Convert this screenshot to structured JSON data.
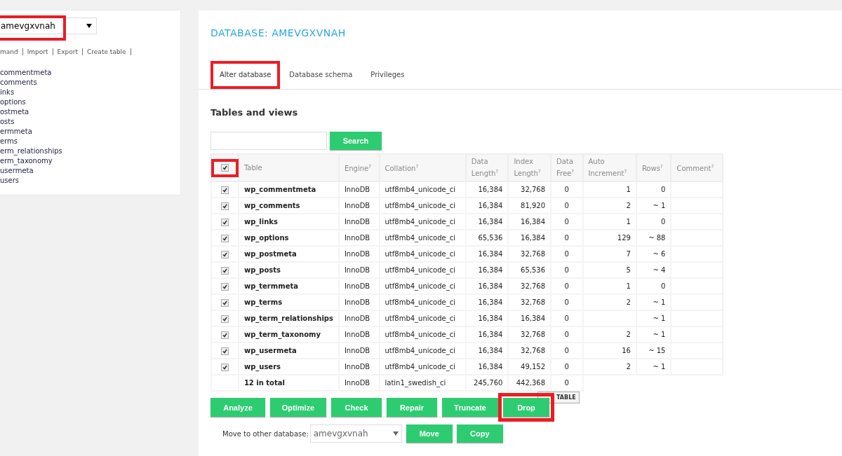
{
  "sidebar": {
    "database_select": {
      "value": "amevgxvnah",
      "highlighted": true
    },
    "links": [
      "mand",
      "Import",
      "Export",
      "Create table"
    ],
    "tables": [
      "commentmeta",
      "comments",
      "inks",
      "options",
      "ostmeta",
      "osts",
      "ermmeta",
      "erms",
      "erm_relationships",
      "erm_taxonomy",
      "usermeta",
      "users"
    ]
  },
  "main": {
    "title": "DATABASE: AMEVGXVNAH",
    "tabs": [
      {
        "label": "Alter database",
        "selected": true,
        "highlighted": true
      },
      {
        "label": "Database schema",
        "selected": false,
        "highlighted": false
      },
      {
        "label": "Privileges",
        "selected": false,
        "highlighted": false
      }
    ],
    "section_title": "Tables and views",
    "search": {
      "button": "Search"
    },
    "table": {
      "select_all": {
        "checked": true,
        "highlighted": true
      },
      "columns": [
        "Table",
        "Engine$^{?}$",
        "Collation$^{?}$",
        "Data Length$^{?}$",
        "Index Length$^{?}$",
        "Data Free$^{?}$",
        "Auto Increment$^{?}$",
        "Rows$^{?}$",
        "Comment$^{?}$"
      ],
      "rows": [
        {
          "checked": true,
          "cells": [
            "wp_commentmeta",
            "InnoDB",
            "utf8mb4_unicode_ci",
            "16,384",
            "32,768",
            "0",
            "1",
            "0",
            ""
          ]
        },
        {
          "checked": true,
          "cells": [
            "wp_comments",
            "InnoDB",
            "utf8mb4_unicode_ci",
            "16,384",
            "81,920",
            "0",
            "2",
            "~ 1",
            ""
          ]
        },
        {
          "checked": true,
          "cells": [
            "wp_links",
            "InnoDB",
            "utf8mb4_unicode_ci",
            "16,384",
            "16,384",
            "0",
            "1",
            "0",
            ""
          ]
        },
        {
          "checked": true,
          "cells": [
            "wp_options",
            "InnoDB",
            "utf8mb4_unicode_ci",
            "65,536",
            "16,384",
            "0",
            "129",
            "~ 88",
            ""
          ]
        },
        {
          "checked": true,
          "cells": [
            "wp_postmeta",
            "InnoDB",
            "utf8mb4_unicode_ci",
            "16,384",
            "32,768",
            "0",
            "7",
            "~ 6",
            ""
          ]
        },
        {
          "checked": true,
          "cells": [
            "wp_posts",
            "InnoDB",
            "utf8mb4_unicode_ci",
            "16,384",
            "65,536",
            "0",
            "5",
            "~ 4",
            ""
          ]
        },
        {
          "checked": true,
          "cells": [
            "wp_termmeta",
            "InnoDB",
            "utf8mb4_unicode_ci",
            "16,384",
            "32,768",
            "0",
            "1",
            "0",
            ""
          ]
        },
        {
          "checked": true,
          "cells": [
            "wp_terms",
            "InnoDB",
            "utf8mb4_unicode_ci",
            "16,384",
            "32,768",
            "0",
            "2",
            "~ 1",
            ""
          ]
        },
        {
          "checked": true,
          "cells": [
            "wp_term_relationships",
            "InnoDB",
            "utf8mb4_unicode_ci",
            "16,384",
            "16,384",
            "0",
            "",
            "~ 1",
            ""
          ]
        },
        {
          "checked": true,
          "cells": [
            "wp_term_taxonomy",
            "InnoDB",
            "utf8mb4_unicode_ci",
            "16,384",
            "32,768",
            "0",
            "2",
            "~ 1",
            ""
          ]
        },
        {
          "checked": true,
          "cells": [
            "wp_usermeta",
            "InnoDB",
            "utf8mb4_unicode_ci",
            "16,384",
            "32,768",
            "0",
            "16",
            "~ 15",
            ""
          ]
        },
        {
          "checked": true,
          "cells": [
            "wp_users",
            "InnoDB",
            "utf8mb4_unicode_ci",
            "16,384",
            "49,152",
            "0",
            "2",
            "~ 1",
            ""
          ]
        }
      ],
      "total": [
        "12 in total",
        "InnoDB",
        "latin1_swedish_ci",
        "245,760",
        "442,368",
        "0"
      ]
    },
    "tooltip": "TABLE",
    "actions": [
      {
        "label": "Analyze",
        "highlighted": false
      },
      {
        "label": "Optimize",
        "highlighted": false
      },
      {
        "label": "Check",
        "highlighted": false
      },
      {
        "label": "Repair",
        "highlighted": false
      },
      {
        "label": "Truncate",
        "highlighted": false
      },
      {
        "label": "Drop",
        "highlighted": true
      }
    ],
    "move": {
      "label": "Move to other database:",
      "select": "amevgxvnah",
      "buttons": [
        "Move",
        "Copy"
      ]
    }
  }
}
